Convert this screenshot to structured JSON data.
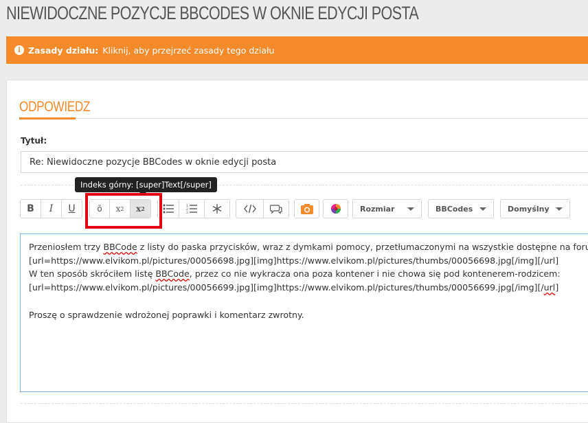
{
  "page": {
    "title": "NIEWIDOCZNE POZYCJE BBCODES W OKNIE EDYCJI POSTA"
  },
  "rules": {
    "label": "Zasady działu:",
    "link_text": "Kliknij, aby przejrzeć zasady tego działu",
    "icon": "info-icon"
  },
  "reply": {
    "heading": "ODPOWIEDZ",
    "title_label": "Tytuł:",
    "title_value": "Re: Niewidoczne pozycje BBCodes w oknie edycji posta"
  },
  "toolbar": {
    "tooltip": "Indeks górny: [super]Text[/super]",
    "bold": "B",
    "italic": "I",
    "underline": "U",
    "overline": "ō",
    "subscript": "x",
    "subscript_index": "2",
    "superscript": "x",
    "superscript_index": "2",
    "size_label": "Rozmiar",
    "bbcodes_label": "BBCodes",
    "default_label": "Domyślny"
  },
  "editor": {
    "line1_a": "Przeniosłem trzy ",
    "line1_spell": "BBCode",
    "line1_b": " z listy do paska przycisków, wraz z dymkami pomocy, przetłumaczonymi na wszystkie dostępne na forum języki:",
    "line2": "[url=https://www.elvikom.pl/pictures/00056698.jpg][img]https://www.elvikom.pl/pictures/thumbs/00056698.jpg[/img][/url]",
    "line3_a": "W ten sposób skróciłem listę ",
    "line3_spell": "BBCode",
    "line3_b": ", przez co nie wykracza ona poza kontener i nie chowa się pod kontenerem-rodzicem:",
    "line4_a": "[url=https://www.elvikom.pl/pictures/00056699.jpg][img]https://www.elvikom.pl/pictures/thumbs/00056699.jpg[/img][/",
    "line4_spell": "url",
    "line4_b": "]",
    "line6": "Proszę o sprawdzenie wdrożonej poprawki i komentarz zwrotny."
  },
  "colors": {
    "accent": "#f58a2b",
    "highlight": "#e00012",
    "editor_border": "#7ab5e4"
  }
}
